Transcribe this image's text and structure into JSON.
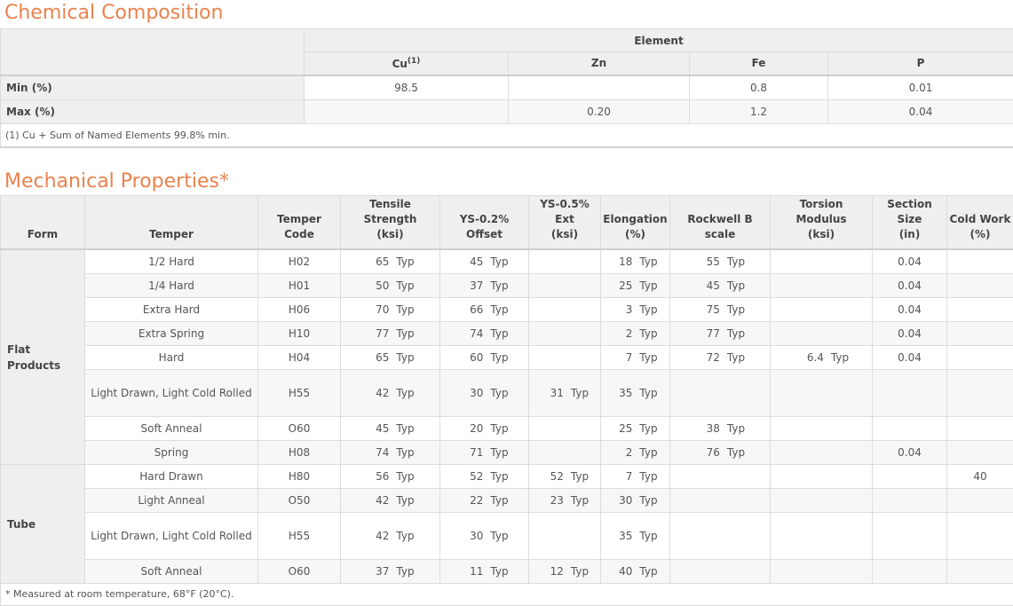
{
  "chemical": {
    "title": "Chemical Composition",
    "group_header": "Element",
    "columns": [
      {
        "label": "Cu",
        "sup": "(1)"
      },
      {
        "label": "Zn",
        "sup": ""
      },
      {
        "label": "Fe",
        "sup": ""
      },
      {
        "label": "P",
        "sup": ""
      }
    ],
    "rows": [
      {
        "label": "Min (%)",
        "values": [
          "98.5",
          "",
          "0.8",
          "0.01"
        ]
      },
      {
        "label": "Max (%)",
        "values": [
          "",
          "0.20",
          "1.2",
          "0.04"
        ]
      }
    ],
    "note": "(1) Cu + Sum of Named Elements 99.8% min."
  },
  "mechanical": {
    "title": "Mechanical Properties*",
    "headers": [
      [
        "Form"
      ],
      [
        "Temper"
      ],
      [
        "Temper",
        "Code"
      ],
      [
        "Tensile",
        "Strength",
        "(ksi)"
      ],
      [
        "YS-0.2%",
        "Offset"
      ],
      [
        "YS-0.5%",
        "Ext",
        "(ksi)"
      ],
      [
        "Elongation",
        "(%)"
      ],
      [
        "Rockwell B",
        "scale"
      ],
      [
        "Torsion",
        "Modulus",
        "(ksi)"
      ],
      [
        "Section",
        "Size",
        "(in)"
      ],
      [
        "Cold Work",
        "(%)"
      ]
    ],
    "groups": [
      {
        "form": [
          "Flat",
          "Products"
        ],
        "rows": [
          {
            "temper": "1/2 Hard",
            "code": "H02",
            "tensile": "65",
            "ys02": "45",
            "ys05": "",
            "elong": "18",
            "rockwell": "55",
            "torsion": "",
            "section": "0.04",
            "cold": ""
          },
          {
            "temper": "1/4 Hard",
            "code": "H01",
            "tensile": "50",
            "ys02": "37",
            "ys05": "",
            "elong": "25",
            "rockwell": "45",
            "torsion": "",
            "section": "0.04",
            "cold": ""
          },
          {
            "temper": "Extra Hard",
            "code": "H06",
            "tensile": "70",
            "ys02": "66",
            "ys05": "",
            "elong": "3",
            "rockwell": "75",
            "torsion": "",
            "section": "0.04",
            "cold": ""
          },
          {
            "temper": "Extra Spring",
            "code": "H10",
            "tensile": "77",
            "ys02": "74",
            "ys05": "",
            "elong": "2",
            "rockwell": "77",
            "torsion": "",
            "section": "0.04",
            "cold": ""
          },
          {
            "temper": "Hard",
            "code": "H04",
            "tensile": "65",
            "ys02": "60",
            "ys05": "",
            "elong": "7",
            "rockwell": "72",
            "torsion": "6.4",
            "section": "0.04",
            "cold": ""
          },
          {
            "temper": "Light Drawn, Light Cold Rolled",
            "code": "H55",
            "tensile": "42",
            "ys02": "30",
            "ys05": "31",
            "elong": "35",
            "rockwell": "",
            "torsion": "",
            "section": "",
            "cold": "",
            "tall": true
          },
          {
            "temper": "Soft Anneal",
            "code": "O60",
            "tensile": "45",
            "ys02": "20",
            "ys05": "",
            "elong": "25",
            "rockwell": "38",
            "torsion": "",
            "section": "",
            "cold": ""
          },
          {
            "temper": "Spring",
            "code": "H08",
            "tensile": "74",
            "ys02": "71",
            "ys05": "",
            "elong": "2",
            "rockwell": "76",
            "torsion": "",
            "section": "0.04",
            "cold": ""
          }
        ]
      },
      {
        "form": [
          "Tube"
        ],
        "rows": [
          {
            "temper": "Hard Drawn",
            "code": "H80",
            "tensile": "56",
            "ys02": "52",
            "ys05": "52",
            "elong": "7",
            "rockwell": "",
            "torsion": "",
            "section": "",
            "cold": "40"
          },
          {
            "temper": "Light Anneal",
            "code": "O50",
            "tensile": "42",
            "ys02": "22",
            "ys05": "23",
            "elong": "30",
            "rockwell": "",
            "torsion": "",
            "section": "",
            "cold": ""
          },
          {
            "temper": "Light Drawn, Light Cold Rolled",
            "code": "H55",
            "tensile": "42",
            "ys02": "30",
            "ys05": "",
            "elong": "35",
            "rockwell": "",
            "torsion": "",
            "section": "",
            "cold": "",
            "tall": true
          },
          {
            "temper": "Soft Anneal",
            "code": "O60",
            "tensile": "37",
            "ys02": "11",
            "ys05": "12",
            "elong": "40",
            "rockwell": "",
            "torsion": "",
            "section": "",
            "cold": ""
          }
        ]
      }
    ],
    "typ_label": "Typ",
    "note": "* Measured at room temperature, 68°F (20°C)."
  }
}
